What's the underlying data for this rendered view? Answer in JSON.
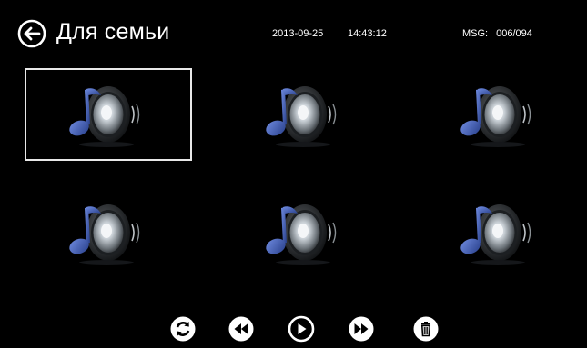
{
  "header": {
    "back_icon": "back-arrow-icon",
    "title": "Для семьи",
    "date": "2013-09-25",
    "time": "14:43:12",
    "msg_label": "MSG:",
    "msg_counter": "006/094"
  },
  "tiles": [
    {
      "icon": "audio-message-icon",
      "selected": true
    },
    {
      "icon": "audio-message-icon",
      "selected": false
    },
    {
      "icon": "audio-message-icon",
      "selected": false
    },
    {
      "icon": "audio-message-icon",
      "selected": false
    },
    {
      "icon": "audio-message-icon",
      "selected": false
    },
    {
      "icon": "audio-message-icon",
      "selected": false
    }
  ],
  "controls": [
    {
      "icon": "refresh-icon"
    },
    {
      "icon": "rewind-icon"
    },
    {
      "icon": "play-icon"
    },
    {
      "icon": "fast-forward-icon"
    },
    {
      "icon": "trash-icon"
    }
  ],
  "colors": {
    "background": "#000000",
    "text": "#ffffff",
    "selection_border": "#e8e8e8",
    "note_blue": "#3d5fb8"
  }
}
